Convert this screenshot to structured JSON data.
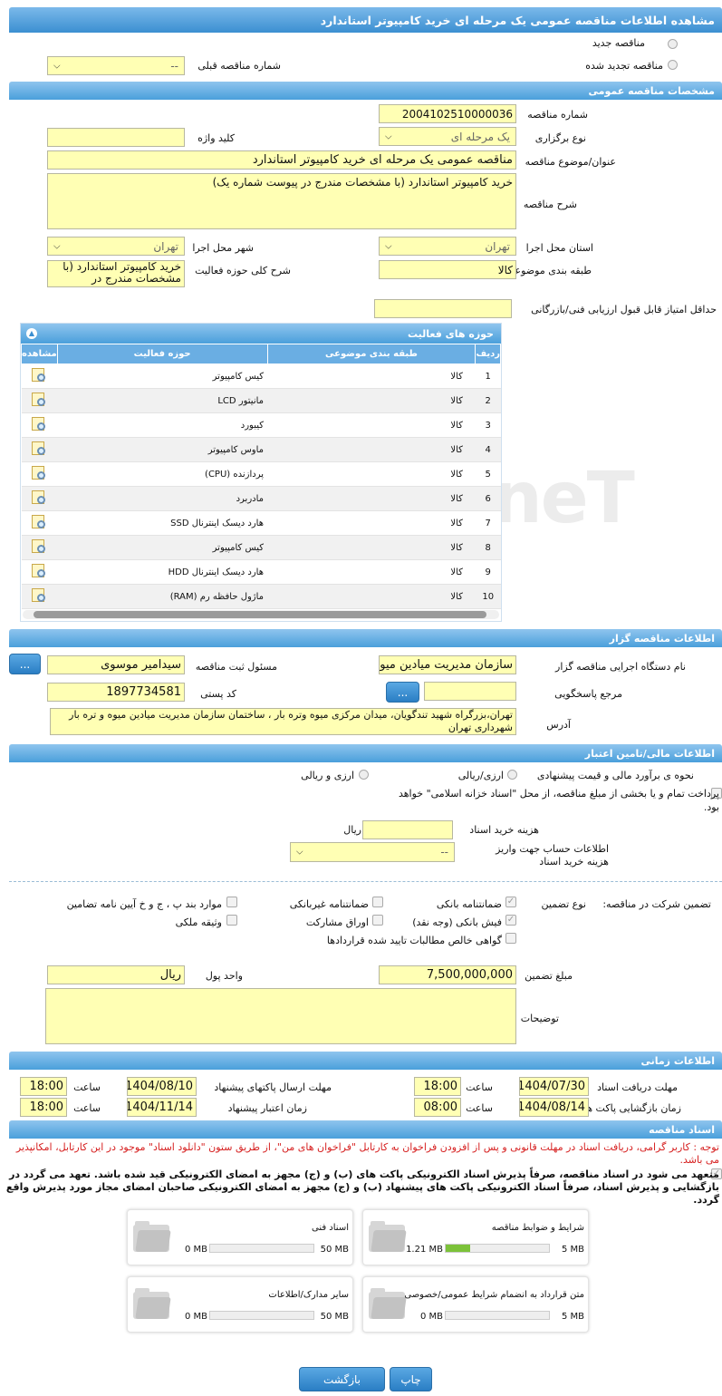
{
  "page_title": "مشاهده اطلاعات مناقصه عمومی یک مرحله ای خرید کامپیوتر استاندارد",
  "top": {
    "new_tender": "مناقصه جدید",
    "renewed_tender": "مناقصه تجدید شده",
    "previous_number_label": "شماره مناقصه قبلی",
    "previous_number_value": "--"
  },
  "general": {
    "section_title": "مشخصات مناقصه عمومی",
    "number_label": "شماره مناقصه",
    "number_value": "2004102510000036",
    "type_label": "نوع برگزاری",
    "type_value": "یک مرحله ای",
    "keyword_label": "کلید واژه",
    "keyword_value": "",
    "subject_label": "عنوان/موضوع مناقصه",
    "subject_value": "مناقصه عمومی یک مرحله ای خرید کامپیوتر استاندارد",
    "desc_label": "شرح مناقصه",
    "desc_value": "خرید کامپیوتر استاندارد (با مشخصات مندرج در پیوست شماره یک)",
    "province_label": "استان محل اجرا",
    "province_value": "تهران",
    "city_label": "شهر محل اجرا",
    "city_value": "تهران",
    "category_label": "طبقه بندی موضوعی",
    "category_value": "کالا",
    "activity_label": "شرح کلی حوزه فعالیت",
    "activity_value": "خرید کامپیوتر استاندارد (با مشخصات مندرج در",
    "min_score_label": "حداقل امتیاز قابل قبول ارزیابی فنی/بازرگانی",
    "min_score_value": ""
  },
  "activities": {
    "title": "حوزه های فعالیت",
    "headers": [
      "ردیف",
      "طبقه بندی موضوعی",
      "حوزه فعالیت",
      "مشاهده"
    ],
    "rows": [
      {
        "n": "1",
        "cat": "کالا",
        "area": "کیس کامپیوتر"
      },
      {
        "n": "2",
        "cat": "کالا",
        "area": "مانیتور LCD"
      },
      {
        "n": "3",
        "cat": "کالا",
        "area": "کیبورد"
      },
      {
        "n": "4",
        "cat": "کالا",
        "area": "ماوس کامپیوتر"
      },
      {
        "n": "5",
        "cat": "کالا",
        "area": "پردازنده (CPU)"
      },
      {
        "n": "6",
        "cat": "کالا",
        "area": "مادربرد"
      },
      {
        "n": "7",
        "cat": "کالا",
        "area": "هارد دیسک اینترنال SSD"
      },
      {
        "n": "8",
        "cat": "کالا",
        "area": "کیس کامپیوتر"
      },
      {
        "n": "9",
        "cat": "کالا",
        "area": "هارد دیسک اینترنال HDD"
      },
      {
        "n": "10",
        "cat": "کالا",
        "area": "ماژول حافظه رم (RAM)"
      }
    ]
  },
  "organizer": {
    "section_title": "اطلاعات مناقصه گزار",
    "org_label": "نام دستگاه اجرایی مناقصه گزار",
    "org_value": "سازمان مدیریت میادین میوه",
    "responsible_label": "مسئول ثبت مناقصه",
    "responsible_value": "سیدامیر موسوی",
    "reference_label": "مرجع پاسخگویی",
    "reference_value": "",
    "postal_label": "کد پستی",
    "postal_value": "1897734581",
    "address_label": "آدرس",
    "address_value": "تهران،بزرگراه شهید تندگویان، میدان مرکزی میوه وتره بار ، ساختمان سازمان مدیریت میادین میوه و تره بار شهرداری تهران",
    "more_btn": "..."
  },
  "finance": {
    "section_title": "اطلاعات مالی/تامین اعتبار",
    "estimate_label": "نحوه ی برآورد مالی و قیمت پیشنهادی",
    "opt_rial": "ارزی/ریالی",
    "opt_both": "ارزی و ریالی",
    "treasury_text": "پرداخت تمام و یا بخشی از مبلغ مناقصه، از محل \"اسناد خزانه اسلامی\" خواهد بود.",
    "doc_cost_label": "هزینه خرید اسناد",
    "doc_cost_value": "",
    "doc_cost_unit": "ریال",
    "account_label": "اطلاعات حساب جهت واریز هزینه خرید اسناد",
    "account_value": "--"
  },
  "guarantee": {
    "participation_label": "تضمین شرکت در مناقصه:",
    "type_label": "نوع تضمین",
    "options": [
      {
        "label": "ضمانتنامه بانکی",
        "checked": true
      },
      {
        "label": "ضمانتنامه غیربانکی",
        "checked": false
      },
      {
        "label": "موارد بند پ ، ج و خ آیین نامه تضامین",
        "checked": false
      },
      {
        "label": "فیش بانکی (وجه نقد)",
        "checked": true
      },
      {
        "label": "اوراق مشارکت",
        "checked": false
      },
      {
        "label": "وثیقه ملکی",
        "checked": false
      },
      {
        "label": "گواهی خالص مطالبات تایید شده قراردادها",
        "checked": false
      }
    ],
    "amount_label": "مبلغ تضمین",
    "amount_value": "7,500,000,000",
    "currency_label": "واحد پول",
    "currency_value": "ریال",
    "notes_label": "توضیحات",
    "notes_value": ""
  },
  "timing": {
    "section_title": "اطلاعات زمانی",
    "receive_label": "مهلت دریافت اسناد",
    "receive_date": "1404/07/30",
    "receive_time": "18:00",
    "send_label": "مهلت ارسال پاکتهای پیشنهاد",
    "send_date": "1404/08/10",
    "send_time": "18:00",
    "open_label": "زمان بازگشایی پاکت ها",
    "open_date": "1404/08/14",
    "open_time": "08:00",
    "validity_label": "زمان اعتبار پیشنهاد",
    "validity_date": "1404/11/14",
    "validity_time": "18:00",
    "time_label": "ساعت"
  },
  "documents": {
    "section_title": "اسناد مناقصه",
    "notice": "توجه : کاربر گرامی، دریافت اسناد در مهلت قانونی و پس از افزودن فراخوان به کارتابل \"فراخوان های من\"، از طریق ستون \"دانلود اسناد\" موجود در این کارتابل، امکانپذیر می باشد.",
    "commitment": "متعهد می شود در اسناد مناقصه، صرفاً پذیرش اسناد الکترونیکی پاکت های (ب) و (ج) مجهز به امضای الکترونیکی قید شده باشد. تعهد می گردد در بازگشایی و پذیرش اسناد، صرفاً اسناد الکترونیکی پاکت های پیشنهاد (ب) و (ج) مجهز به امضای الکترونیکی صاحبان امضای مجاز مورد پذیرش واقع گردد.",
    "cards": [
      {
        "name": "شرایط و ضوابط مناقصه",
        "used": "1.21 MB",
        "max": "5 MB",
        "fill": 0.24
      },
      {
        "name": "اسناد فنی",
        "used": "0 MB",
        "max": "50 MB",
        "fill": 0
      },
      {
        "name": "متن قرارداد به انضمام شرایط عمومی/خصوصی",
        "used": "0 MB",
        "max": "5 MB",
        "fill": 0
      },
      {
        "name": "سایر مدارک/اطلاعات",
        "used": "0 MB",
        "max": "50 MB",
        "fill": 0
      }
    ]
  },
  "buttons": {
    "print": "چاپ",
    "back": "بازگشت"
  },
  "watermark": "AriaTender.neT"
}
